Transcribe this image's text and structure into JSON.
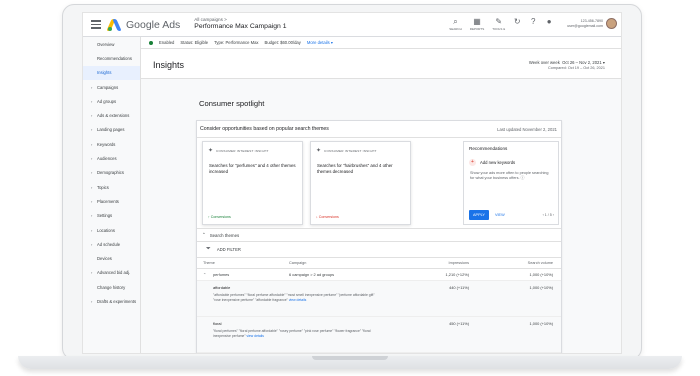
{
  "header": {
    "app_name": "Google Ads",
    "breadcrumb_small": "All campaigns >",
    "campaign_title": "Performance Max Campaign 1",
    "tools": [
      {
        "icon": "search-icon",
        "label": "SEARCH"
      },
      {
        "icon": "reports-icon",
        "label": "REPORTS"
      },
      {
        "icon": "tools-icon",
        "label": "TOOLS &"
      },
      {
        "icon": "refresh-icon",
        "label": ""
      },
      {
        "icon": "help-icon",
        "label": ""
      },
      {
        "icon": "notifications-icon",
        "label": ""
      }
    ],
    "account_id": "123-456-7890",
    "account_email": "user@googlemail.com"
  },
  "sidebar": {
    "items": [
      {
        "label": "Overview",
        "kind": "sub"
      },
      {
        "label": "Recommendations",
        "kind": "sub"
      },
      {
        "label": "Insights",
        "kind": "sub",
        "active": true
      },
      {
        "label": "Campaigns",
        "kind": "section"
      },
      {
        "label": "Ad groups",
        "kind": "section"
      },
      {
        "label": "Ads & extensions",
        "kind": "section"
      },
      {
        "label": "Landing pages",
        "kind": "section"
      },
      {
        "label": "Keywords",
        "kind": "section"
      },
      {
        "label": "Audiences",
        "kind": "section"
      },
      {
        "label": "Demographics",
        "kind": "section"
      },
      {
        "label": "Topics",
        "kind": "section"
      },
      {
        "label": "Placements",
        "kind": "section"
      },
      {
        "label": "Settings",
        "kind": "section"
      },
      {
        "label": "Locations",
        "kind": "section"
      },
      {
        "label": "Ad schedule",
        "kind": "section"
      },
      {
        "label": "Devices",
        "kind": "plain"
      },
      {
        "label": "Advanced bid adj.",
        "kind": "section"
      },
      {
        "label": "Change history",
        "kind": "plain"
      },
      {
        "label": "Drafts & experiments",
        "kind": "section"
      }
    ]
  },
  "status_strip": {
    "enabled": "Enabled",
    "status": "Status: Eligible",
    "type": "Type: Performance Max",
    "budget": "Budget: $60.00/day",
    "more": "More details"
  },
  "page": {
    "title": "Insights",
    "range_label": "Week over week",
    "range_value": "Oct 26 – Nov 2, 2021",
    "compared": "Compared: Oct 19 – Oct 26, 2021"
  },
  "spotlight": {
    "title": "Consumer spotlight",
    "subtitle": "Consider opportunities based on popular search themes",
    "updated": "Last updated November 2, 2021",
    "cards": [
      {
        "kicker": "CONSUMER INTEREST INSIGHT",
        "text": "Searches for \"perfumes\" and 4 other themes increased",
        "badge": "↑ Conversions",
        "trend": "up"
      },
      {
        "kicker": "CONSUMER INTEREST INSIGHT",
        "text": "Searches for \"hairbrushes\" and 4 other themes decreased",
        "badge": "↓ Conversions",
        "trend": "down"
      }
    ],
    "recommendation": {
      "title": "Recommendations",
      "name": "Add new keywords",
      "desc": "Show your ads more often to people searching for what your business offers.",
      "apply": "APPLY",
      "view": "VIEW",
      "pager": "‹  1 / 5  ›"
    }
  },
  "themes": {
    "header": "Search themes",
    "filter": "ADD FILTER",
    "columns": [
      "Theme",
      "Campaign",
      "Impressions",
      "Search volume"
    ],
    "rows": [
      {
        "theme": "perfumes",
        "campaign": "6 campaign > 2 ad groups",
        "impressions": "1,210 (+12%)",
        "volume": "1,000 (+10%)"
      }
    ],
    "subrows": [
      {
        "name": "affordable",
        "queries": "\"affordable perfumes\" \"floral perfume affordable\" \"most smell inexpensive perfume\" \"perfume affordable gift\" \"rose inexpensive perfume\" \"affordable fragrance\"",
        "link": "view details",
        "impressions": "440 (+11%)",
        "volume": "1,000 (+10%)"
      },
      {
        "name": "floral",
        "queries": "\"floral perfumes\" \"floral perfume affordable\" \"rosey perfume\" \"pink rose perfume\" \"flower fragrance\" \"floral inexpensive perfume\"",
        "link": "view details",
        "impressions": "450 (+11%)",
        "volume": "1,000 (+10%)"
      }
    ]
  },
  "colors": {
    "accent": "#1a73e8",
    "positive": "#188038",
    "negative": "#d93025"
  }
}
